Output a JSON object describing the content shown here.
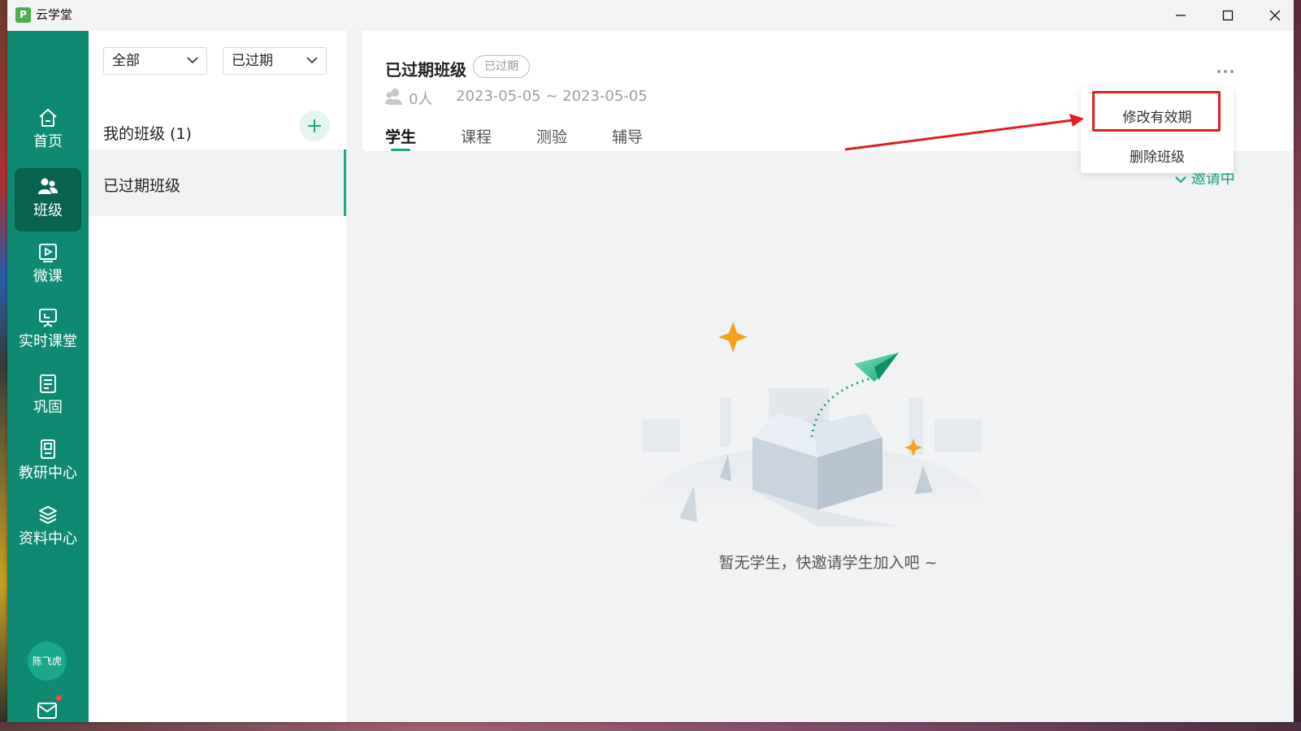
{
  "window": {
    "app_title": "云学堂",
    "logo_glyph": "P",
    "controls": [
      "minimize",
      "maximize",
      "close"
    ]
  },
  "sidebar": {
    "items": [
      {
        "label": "首页",
        "icon": "home-icon"
      },
      {
        "label": "班级",
        "icon": "class-icon",
        "active": true
      },
      {
        "label": "微课",
        "icon": "video-lesson-icon"
      },
      {
        "label": "实时课堂",
        "icon": "live-class-icon"
      },
      {
        "label": "巩固",
        "icon": "practice-icon"
      },
      {
        "label": "教研中心",
        "icon": "research-icon"
      },
      {
        "label": "资料中心",
        "icon": "layers-icon"
      }
    ],
    "user_name": "陈飞虎",
    "mail_icon": "mail-icon",
    "accent": "#0e8a72"
  },
  "class_list": {
    "filter_scope": "全部",
    "filter_status": "已过期",
    "section_title": "我的班级 (1)",
    "classes": [
      {
        "name": "已过期班级",
        "selected": true
      }
    ]
  },
  "class_detail": {
    "title": "已过期班级",
    "status_badge": "已过期",
    "member_count": "0人",
    "date_range": "2023-05-05 ~ 2023-05-05",
    "tabs": [
      "学生",
      "课程",
      "测验",
      "辅导"
    ],
    "active_tab": "学生",
    "invite_partial": "邀请中",
    "empty_message": "暂无学生，快邀请学生加入吧 ~"
  },
  "more_menu": {
    "items": [
      "修改有效期",
      "删除班级"
    ],
    "highlighted": "修改有效期"
  },
  "colors": {
    "brand_green": "#17a887",
    "annotation_red": "#e21e1e"
  }
}
